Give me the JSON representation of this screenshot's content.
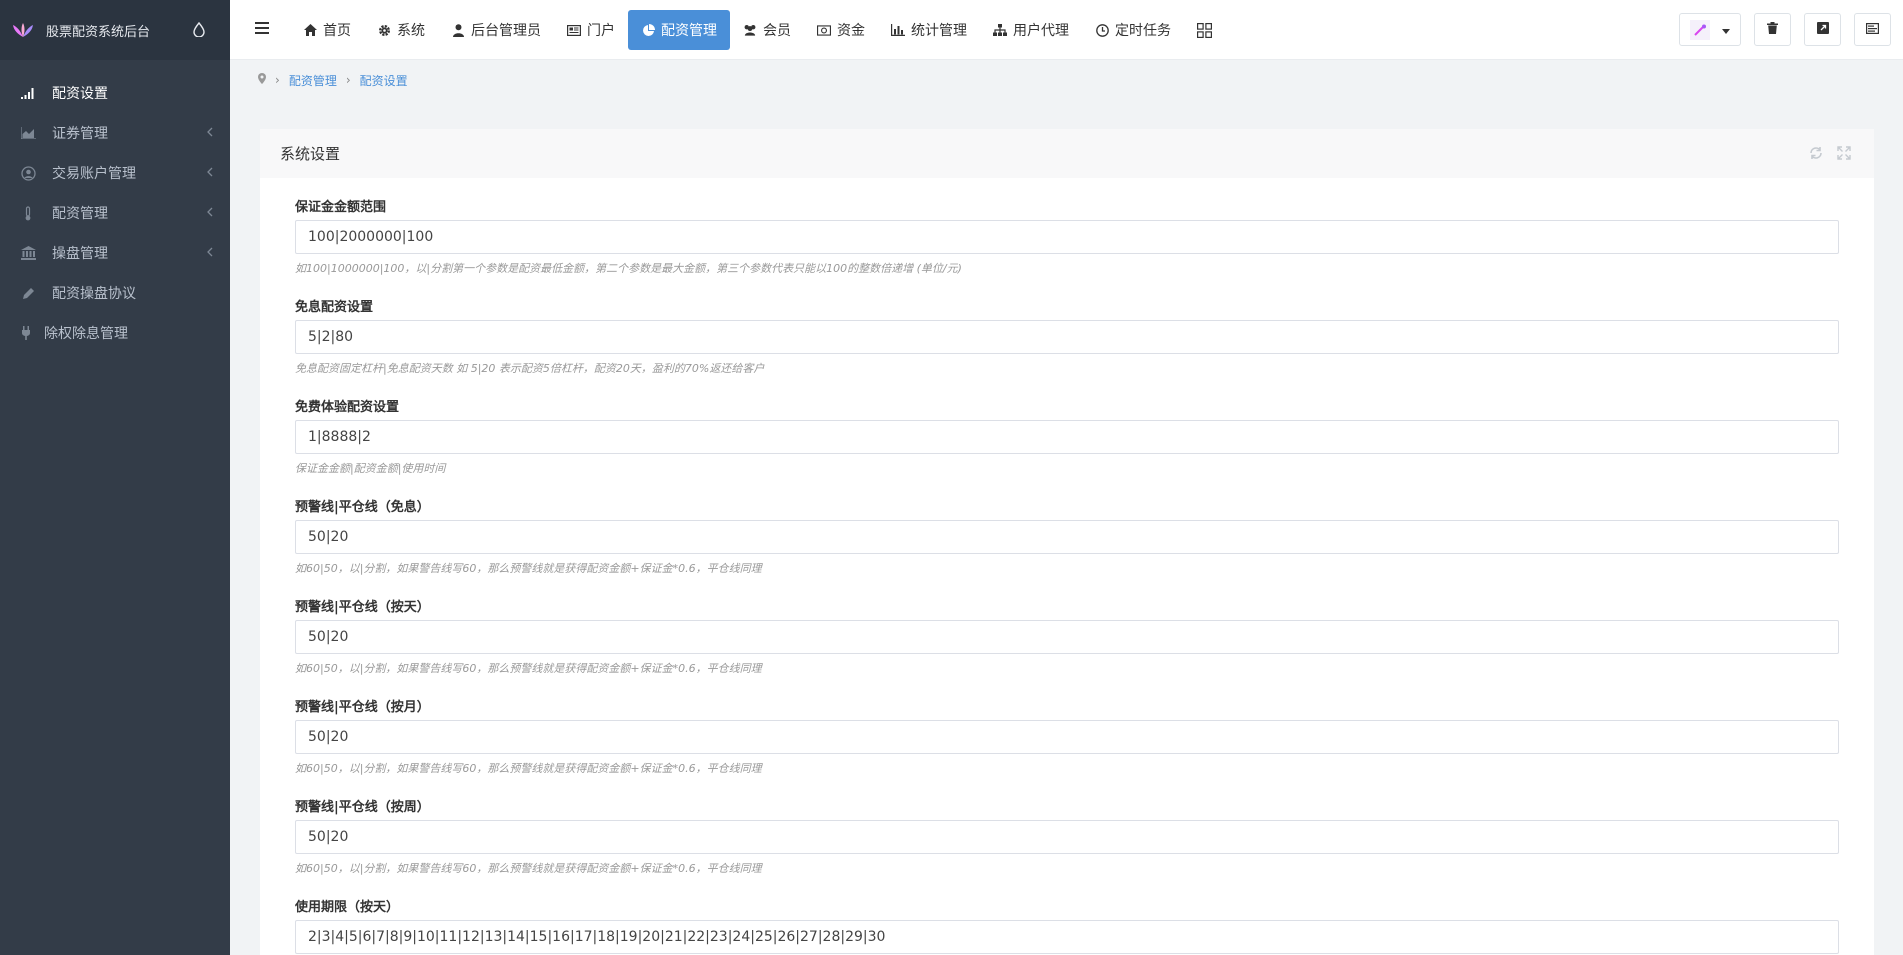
{
  "app": {
    "title": "股票配资系统后台"
  },
  "sidebar": {
    "items": [
      {
        "label": "配资设置",
        "icon": "signal-icon"
      },
      {
        "label": "证券管理",
        "icon": "area-chart-icon"
      },
      {
        "label": "交易账户管理",
        "icon": "user-circle-icon"
      },
      {
        "label": "配资管理",
        "icon": "thermometer-icon"
      },
      {
        "label": "操盘管理",
        "icon": "bank-icon"
      },
      {
        "label": "配资操盘协议",
        "icon": "pencil-icon"
      },
      {
        "label": "除权除息管理",
        "icon": "plug-icon"
      }
    ]
  },
  "nav": {
    "items": [
      {
        "label": "首页"
      },
      {
        "label": "系统"
      },
      {
        "label": "后台管理员"
      },
      {
        "label": "门户"
      },
      {
        "label": "配资管理"
      },
      {
        "label": "会员"
      },
      {
        "label": "资金"
      },
      {
        "label": "统计管理"
      },
      {
        "label": "用户代理"
      },
      {
        "label": "定时任务"
      }
    ]
  },
  "breadcrumb": {
    "items": [
      "配资管理",
      "配资设置"
    ]
  },
  "card": {
    "title": "系统设置"
  },
  "form": {
    "fields": [
      {
        "label": "保证金金额范围",
        "value": "100|2000000|100",
        "help": "如100|1000000|100，以|分割第一个参数是配资最低金额，第二个参数是最大金额，第三个参数代表只能以100的整数倍递增 (单位/元)"
      },
      {
        "label": "免息配资设置",
        "value": "5|2|80",
        "help": "免息配资固定杠杆|免息配资天数 如 5|20 表示配资5倍杠杆，配资20天，盈利的70%返还给客户"
      },
      {
        "label": "免费体验配资设置",
        "value": "1|8888|2",
        "help": "保证金金额|配资金额|使用时间"
      },
      {
        "label": "预警线|平仓线（免息）",
        "value": "50|20",
        "help": "如60|50，以|分割，如果警告线写60，那么预警线就是获得配资金额+保证金*0.6，平仓线同理"
      },
      {
        "label": "预警线|平仓线（按天）",
        "value": "50|20",
        "help": "如60|50，以|分割，如果警告线写60，那么预警线就是获得配资金额+保证金*0.6，平仓线同理"
      },
      {
        "label": "预警线|平仓线（按月）",
        "value": "50|20",
        "help": "如60|50，以|分割，如果警告线写60，那么预警线就是获得配资金额+保证金*0.6，平仓线同理"
      },
      {
        "label": "预警线|平仓线（按周）",
        "value": "50|20",
        "help": "如60|50，以|分割，如果警告线写60，那么预警线就是获得配资金额+保证金*0.6，平仓线同理"
      },
      {
        "label": "使用期限（按天）",
        "value": "2|3|4|5|6|7|8|9|10|11|12|13|14|15|16|17|18|19|20|21|22|23|24|25|26|27|28|29|30",
        "help": ""
      }
    ]
  },
  "colors": {
    "sidebar_bg": "#333c48",
    "brand_bg": "#2b3440",
    "accent": "#4a8fd8"
  }
}
